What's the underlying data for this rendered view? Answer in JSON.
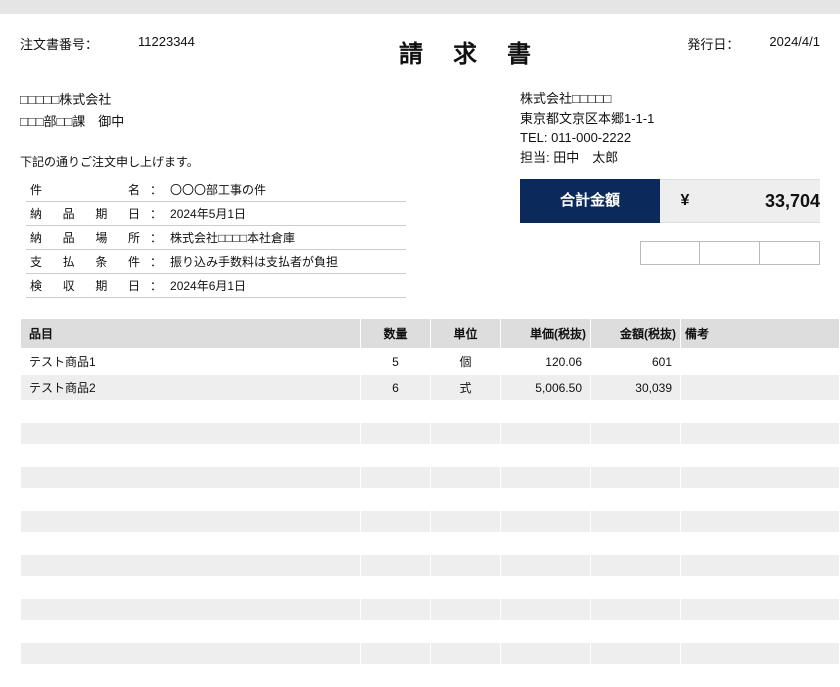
{
  "header": {
    "order_label": "注文書番号：",
    "order_number": "11223344",
    "title": "請求書",
    "issue_label": "発行日：",
    "issue_date": "2024/4/1"
  },
  "client": {
    "name": "□□□□□株式会社",
    "dept": "□□□部□□課　御中",
    "intro": "下記の通りご注文申し上げます。"
  },
  "sender": {
    "name": "株式会社□□□□□",
    "address": "東京都文京区本郷1-1-1",
    "tel": "TEL: 011-000-2222",
    "contact": "担当: 田中　太郎"
  },
  "details": {
    "subject_label": "件名",
    "subject": "〇〇〇部工事の件",
    "delivery_label": "納品期日",
    "delivery": "2024年5月1日",
    "place_label": "納品場所",
    "place": "株式会社□□□□本社倉庫",
    "payment_label": "支払条件",
    "payment": "振り込み手数料は支払者が負担",
    "inspect_label": "検収期日",
    "inspect": "2024年6月1日"
  },
  "total": {
    "label": "合計金額",
    "currency": "¥",
    "amount": "33,704"
  },
  "columns": {
    "item": "品目",
    "qty": "数量",
    "unit": "単位",
    "price": "単価(税抜)",
    "amount": "金額(税抜)",
    "note": "備考"
  },
  "items": [
    {
      "name": "テスト商品1",
      "qty": "5",
      "unit": "個",
      "price": "120.06",
      "amount": "601",
      "note": ""
    },
    {
      "name": "テスト商品2",
      "qty": "6",
      "unit": "式",
      "price": "5,006.50",
      "amount": "30,039",
      "note": ""
    }
  ],
  "chart_data": {
    "type": "table",
    "title": "請求書",
    "columns": [
      "品目",
      "数量",
      "単位",
      "単価(税抜)",
      "金額(税抜)",
      "備考"
    ],
    "rows": [
      [
        "テスト商品1",
        5,
        "個",
        120.06,
        601,
        ""
      ],
      [
        "テスト商品2",
        6,
        "式",
        5006.5,
        30039,
        ""
      ]
    ],
    "total": 33704
  }
}
